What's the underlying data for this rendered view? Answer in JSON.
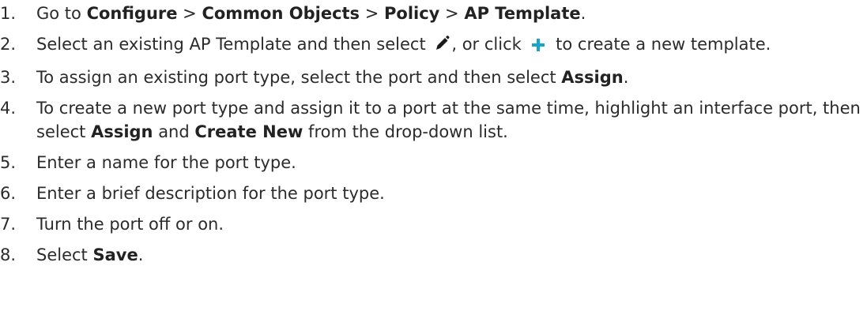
{
  "steps": [
    {
      "num": "1.",
      "t1": "Go to ",
      "b1": "Configure",
      "t2": " > ",
      "b2": "Common Objects",
      "t3": " > ",
      "b3": "Policy",
      "t4": " > ",
      "b4": "AP Template",
      "t5": "."
    },
    {
      "num": "2.",
      "t1": "Select an existing AP Template and then select ",
      "t2": ", or click ",
      "t3": " to create a new template."
    },
    {
      "num": "3.",
      "t1": "To assign an existing port type, select the port and then select ",
      "b1": "Assign",
      "t2": "."
    },
    {
      "num": "4.",
      "t1": "To create a new port type and assign it to a port at the same time, highlight an interface port, then select ",
      "b1": "Assign",
      "t2": " and ",
      "b2": "Create New",
      "t3": " from the drop-down list."
    },
    {
      "num": "5.",
      "t1": "Enter a name for the port type."
    },
    {
      "num": "6.",
      "t1": "Enter a brief description for the port type."
    },
    {
      "num": "7.",
      "t1": "Turn the port off or on."
    },
    {
      "num": "8.",
      "t1": "Select ",
      "b1": "Save",
      "t2": "."
    }
  ],
  "icons": {
    "edit": "pencil-icon",
    "add": "plus-icon",
    "add_color": "#17a5c8",
    "edit_color": "#1a1a1a"
  }
}
